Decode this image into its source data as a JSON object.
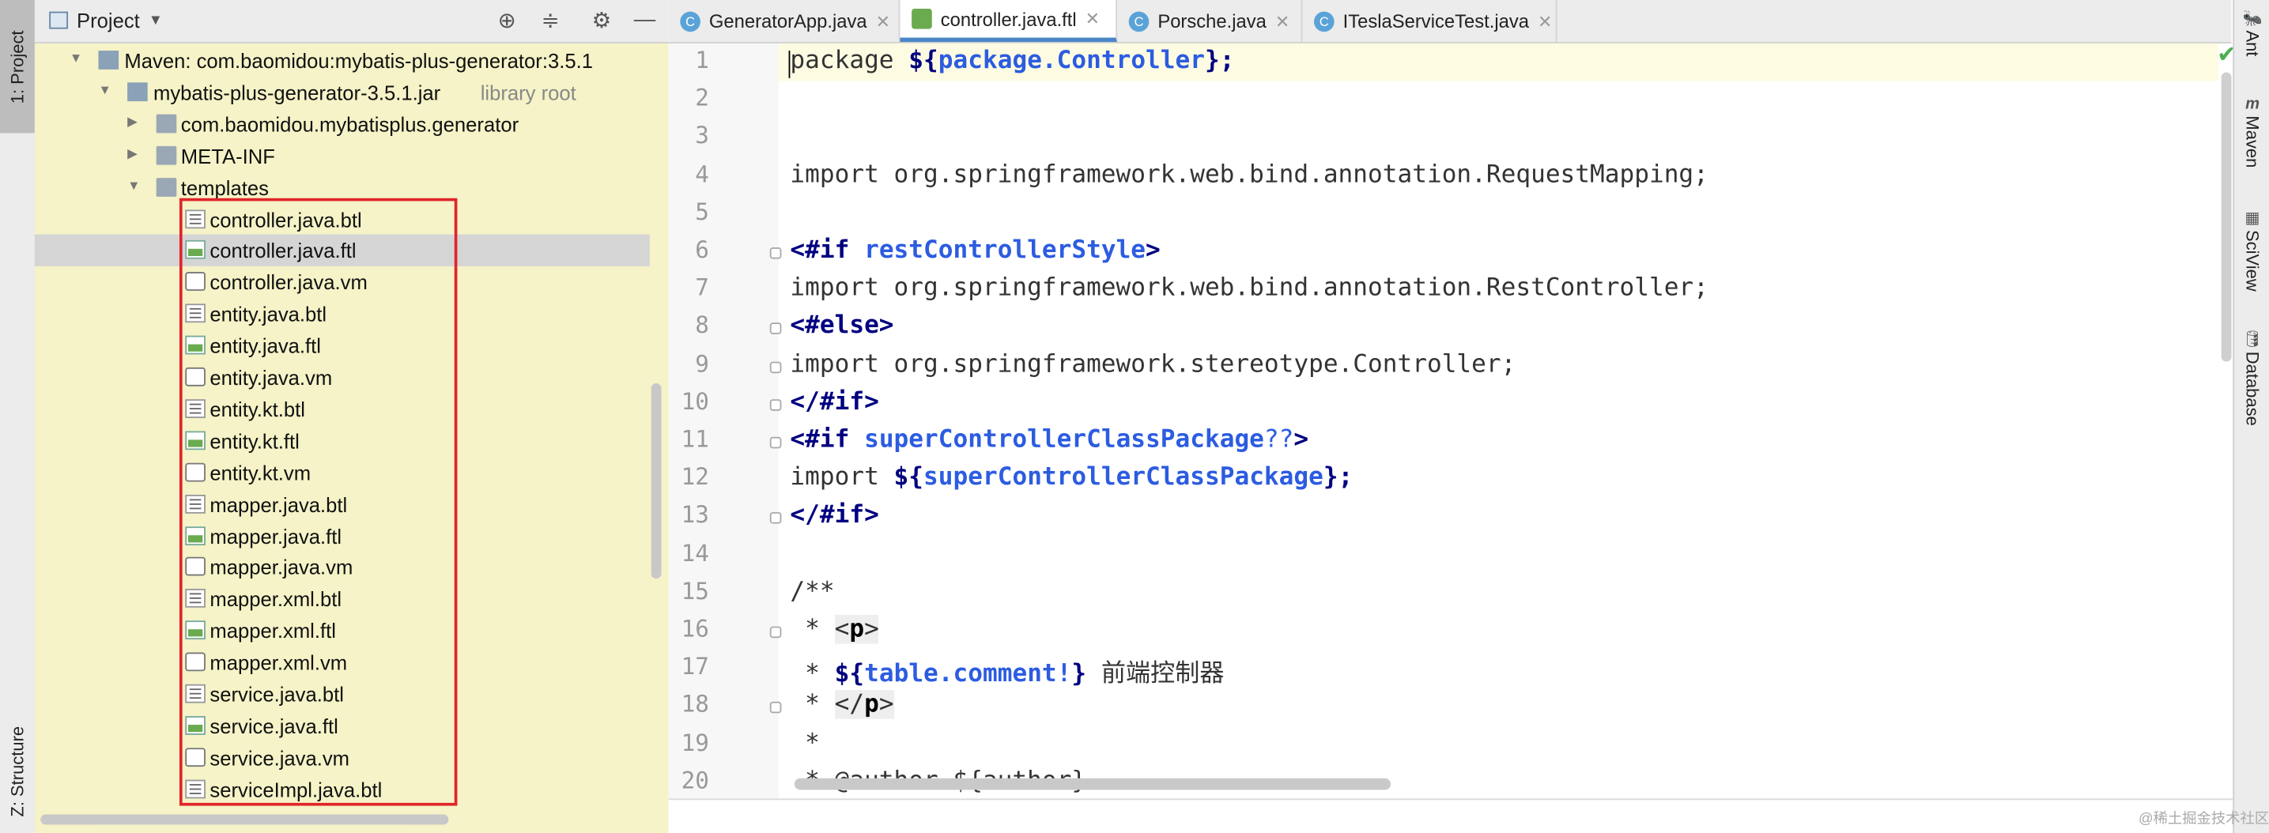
{
  "left_strip": {
    "project_tab": "1: Project",
    "structure_tab": "Z: Structure"
  },
  "project_panel": {
    "title": "Project",
    "header_icons": [
      "crosshair-icon",
      "collapse-icon",
      "gear-icon",
      "minimize-icon"
    ],
    "tree": [
      {
        "label": "Maven: com.baomidou:mybatis-plus-generator:3.5.1",
        "type": "maven",
        "expanded": true
      },
      {
        "label": "mybatis-plus-generator-3.5.1.jar",
        "suffix": "library root",
        "type": "jar",
        "expanded": true
      },
      {
        "label": "com.baomidou.mybatisplus.generator",
        "type": "folder",
        "expanded": false
      },
      {
        "label": "META-INF",
        "type": "folder",
        "expanded": false
      },
      {
        "label": "templates",
        "type": "folder",
        "expanded": true
      },
      {
        "label": "controller.java.btl",
        "type": "btl"
      },
      {
        "label": "controller.java.ftl",
        "type": "ftl",
        "selected": true
      },
      {
        "label": "controller.java.vm",
        "type": "vm"
      },
      {
        "label": "entity.java.btl",
        "type": "btl"
      },
      {
        "label": "entity.java.ftl",
        "type": "ftl"
      },
      {
        "label": "entity.java.vm",
        "type": "vm"
      },
      {
        "label": "entity.kt.btl",
        "type": "btl"
      },
      {
        "label": "entity.kt.ftl",
        "type": "ftl"
      },
      {
        "label": "entity.kt.vm",
        "type": "vm"
      },
      {
        "label": "mapper.java.btl",
        "type": "btl"
      },
      {
        "label": "mapper.java.ftl",
        "type": "ftl"
      },
      {
        "label": "mapper.java.vm",
        "type": "vm"
      },
      {
        "label": "mapper.xml.btl",
        "type": "btl"
      },
      {
        "label": "mapper.xml.ftl",
        "type": "ftl"
      },
      {
        "label": "mapper.xml.vm",
        "type": "vm"
      },
      {
        "label": "service.java.btl",
        "type": "btl"
      },
      {
        "label": "service.java.ftl",
        "type": "ftl"
      },
      {
        "label": "service.java.vm",
        "type": "vm"
      },
      {
        "label": "serviceImpl.java.btl",
        "type": "btl"
      }
    ]
  },
  "tabs": [
    {
      "label": "GeneratorApp.java",
      "icon": "java-class-icon",
      "active": false
    },
    {
      "label": "controller.java.ftl",
      "icon": "ftl-file-icon",
      "active": true
    },
    {
      "label": "Porsche.java",
      "icon": "java-class-icon",
      "active": false
    },
    {
      "label": "ITeslaServiceTest.java",
      "icon": "java-class-icon",
      "active": false
    }
  ],
  "editor": {
    "line_numbers": [
      "1",
      "2",
      "3",
      "4",
      "5",
      "6",
      "7",
      "8",
      "9",
      "10",
      "11",
      "12",
      "13",
      "14",
      "15",
      "16",
      "17",
      "18",
      "19",
      "20"
    ],
    "lines": [
      [
        {
          "t": "package ",
          "c": "cmt"
        },
        {
          "t": "${",
          "c": "kw"
        },
        {
          "t": "package.Controller",
          "c": "var"
        },
        {
          "t": "};",
          "c": "kw"
        }
      ],
      [],
      [],
      [
        {
          "t": "import org.springframework.web.bind.annotation.RequestMapping;",
          "c": "cmt"
        }
      ],
      [],
      [
        {
          "t": "<#if ",
          "c": "dir"
        },
        {
          "t": "restControllerStyle",
          "c": "var"
        },
        {
          "t": ">",
          "c": "dir"
        }
      ],
      [
        {
          "t": "import org.springframework.web.bind.annotation.RestController;",
          "c": "cmt"
        }
      ],
      [
        {
          "t": "<#else>",
          "c": "dir"
        }
      ],
      [
        {
          "t": "import org.springframework.stereotype.Controller;",
          "c": "cmt"
        }
      ],
      [
        {
          "t": "</#if>",
          "c": "dir"
        }
      ],
      [
        {
          "t": "<#if ",
          "c": "dir"
        },
        {
          "t": "superControllerClassPackage",
          "c": "var"
        },
        {
          "t": "??",
          "c": "var2"
        },
        {
          "t": ">",
          "c": "dir"
        }
      ],
      [
        {
          "t": "import ",
          "c": "cmt"
        },
        {
          "t": "${",
          "c": "kw"
        },
        {
          "t": "superControllerClassPackage",
          "c": "var"
        },
        {
          "t": "};",
          "c": "kw"
        }
      ],
      [
        {
          "t": "</#if>",
          "c": "dir"
        }
      ],
      [],
      [
        {
          "t": "/**",
          "c": "cmt"
        }
      ],
      [
        {
          "t": " * ",
          "c": "cmt"
        },
        {
          "t": "<",
          "c": "ptag2"
        },
        {
          "t": "p",
          "c": "ptag"
        },
        {
          "t": ">",
          "c": "ptag2"
        }
      ],
      [
        {
          "t": " * ",
          "c": "cmt"
        },
        {
          "t": "${",
          "c": "kw"
        },
        {
          "t": "table.comment!",
          "c": "var"
        },
        {
          "t": "}",
          "c": "kw"
        },
        {
          "t": " 前端控制器",
          "c": "cmt"
        }
      ],
      [
        {
          "t": " * ",
          "c": "cmt"
        },
        {
          "t": "</",
          "c": "ptag2"
        },
        {
          "t": "p",
          "c": "ptag"
        },
        {
          "t": ">",
          "c": "ptag2"
        }
      ],
      [
        {
          "t": " *",
          "c": "cmt"
        }
      ],
      [
        {
          "t": " * @author ${author}",
          "c": "cmt"
        }
      ]
    ],
    "folded_lines": [
      6,
      8,
      9,
      10,
      11,
      13,
      16,
      18
    ]
  },
  "right_strip": [
    "Ant",
    "Maven",
    "SciView",
    "Database"
  ],
  "watermark": "@稀土掘金技术社区"
}
